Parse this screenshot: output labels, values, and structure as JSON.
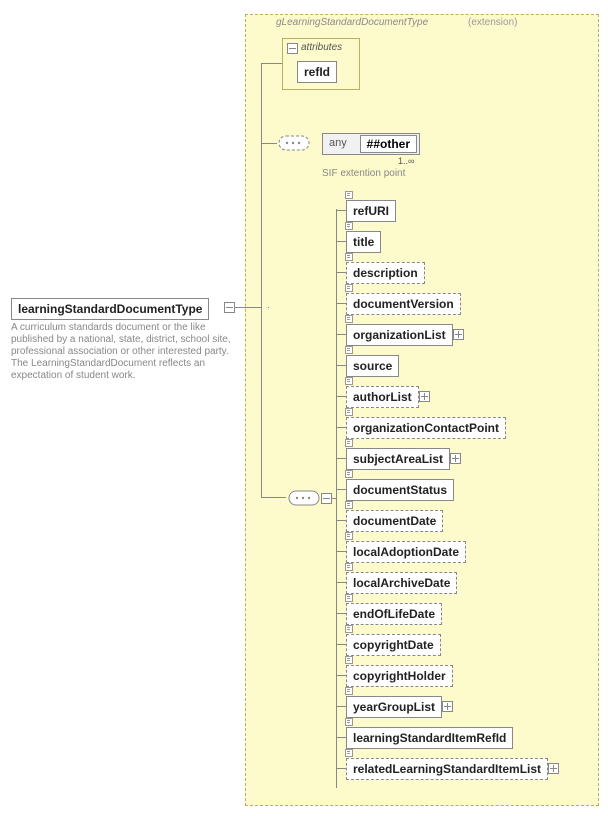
{
  "group": {
    "title": "gLearningStandardDocumentType",
    "ext_label": "(extension)"
  },
  "attributes_box": {
    "label": "attributes",
    "item": "refId"
  },
  "any_widget": {
    "label": "any",
    "value": "##other",
    "cardinality": "1..∞",
    "note": "SIF extention point"
  },
  "root": {
    "label": "learningStandardDocumentType",
    "description": "A curriculum standards document or the like published by a national, state, district, school site, professional association or other interested party. The LearningStandardDocument reflects an expectation of student work."
  },
  "elements": [
    {
      "label": "refURI",
      "solid": true,
      "expand": false
    },
    {
      "label": "title",
      "solid": true,
      "expand": false
    },
    {
      "label": "description",
      "solid": false,
      "expand": false
    },
    {
      "label": "documentVersion",
      "solid": false,
      "expand": false
    },
    {
      "label": "organizationList",
      "solid": true,
      "expand": true
    },
    {
      "label": "source",
      "solid": true,
      "expand": false
    },
    {
      "label": "authorList",
      "solid": false,
      "expand": true
    },
    {
      "label": "organizationContactPoint",
      "solid": false,
      "expand": false
    },
    {
      "label": "subjectAreaList",
      "solid": true,
      "expand": true
    },
    {
      "label": "documentStatus",
      "solid": true,
      "expand": false
    },
    {
      "label": "documentDate",
      "solid": false,
      "expand": false
    },
    {
      "label": "localAdoptionDate",
      "solid": false,
      "expand": false
    },
    {
      "label": "localArchiveDate",
      "solid": false,
      "expand": false
    },
    {
      "label": "endOfLifeDate",
      "solid": false,
      "expand": false
    },
    {
      "label": "copyrightDate",
      "solid": false,
      "expand": false
    },
    {
      "label": "copyrightHolder",
      "solid": false,
      "expand": false
    },
    {
      "label": "yearGroupList",
      "solid": true,
      "expand": true
    },
    {
      "label": "learningStandardItemRefId",
      "solid": true,
      "expand": false
    },
    {
      "label": "relatedLearningStandardItemList",
      "solid": false,
      "expand": true
    }
  ]
}
